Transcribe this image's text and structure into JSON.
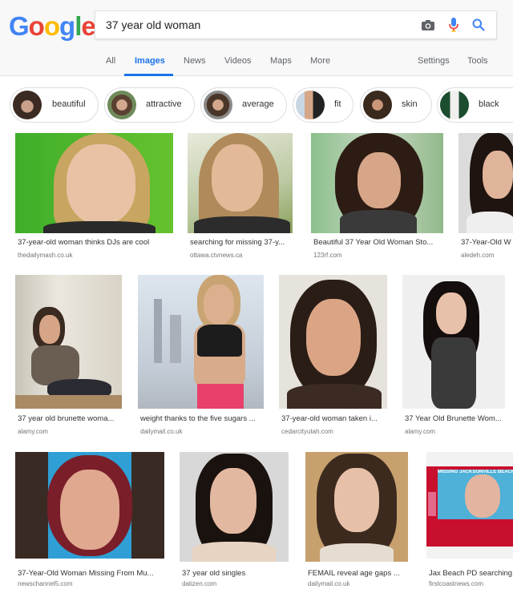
{
  "logo": {
    "letters": [
      "G",
      "o",
      "o",
      "g",
      "l",
      "e"
    ],
    "colors": [
      "#4285f4",
      "#ea4335",
      "#fbbc05",
      "#4285f4",
      "#34a853",
      "#ea4335"
    ]
  },
  "search": {
    "query": "37 year old woman"
  },
  "tabs": [
    {
      "label": "All"
    },
    {
      "label": "Images"
    },
    {
      "label": "News"
    },
    {
      "label": "Videos"
    },
    {
      "label": "Maps"
    },
    {
      "label": "More"
    },
    {
      "label": "Settings"
    },
    {
      "label": "Tools"
    }
  ],
  "chips": [
    {
      "label": "beautiful"
    },
    {
      "label": "attractive"
    },
    {
      "label": "average"
    },
    {
      "label": "fit"
    },
    {
      "label": "skin"
    },
    {
      "label": "black"
    }
  ],
  "results": [
    {
      "caption": "37-year-old woman thinks DJs are cool",
      "source": "thedailymash.co.uk"
    },
    {
      "caption": "searching for missing 37-y...",
      "source": "ottawa.ctvnews.ca"
    },
    {
      "caption": "Beautiful 37 Year Old Woman Sto...",
      "source": "123rf.com"
    },
    {
      "caption": "37-Year-Old W",
      "source": "aledeh.com"
    },
    {
      "caption": "37 year old brunette woma...",
      "source": "alamy.com"
    },
    {
      "caption": "weight thanks to the five sugars ...",
      "source": "dailymail.co.uk"
    },
    {
      "caption": "37-year-old woman taken i...",
      "source": "cedarcityutah.com"
    },
    {
      "caption": "37 Year Old Brunette Wom...",
      "source": "alamy.com"
    },
    {
      "caption": "37-Year-Old Woman Missing From Mu...",
      "source": "newschannel5.com"
    },
    {
      "caption": "37 year old singles",
      "source": "datizen.com"
    },
    {
      "caption": "FEMAIL reveal age gaps ...",
      "source": "dailymail.co.uk"
    },
    {
      "caption": "Jax Beach PD searching",
      "source": "firstcoastnews.com"
    }
  ],
  "overlay_text": {
    "news_banner": "MISSING JACKSONVILLE BEACH WOM"
  },
  "colors": {
    "accent": "#1a73e8",
    "camera_icon": "#5f6368",
    "mic_blue": "#4285f4",
    "mic_red": "#ea4335"
  }
}
